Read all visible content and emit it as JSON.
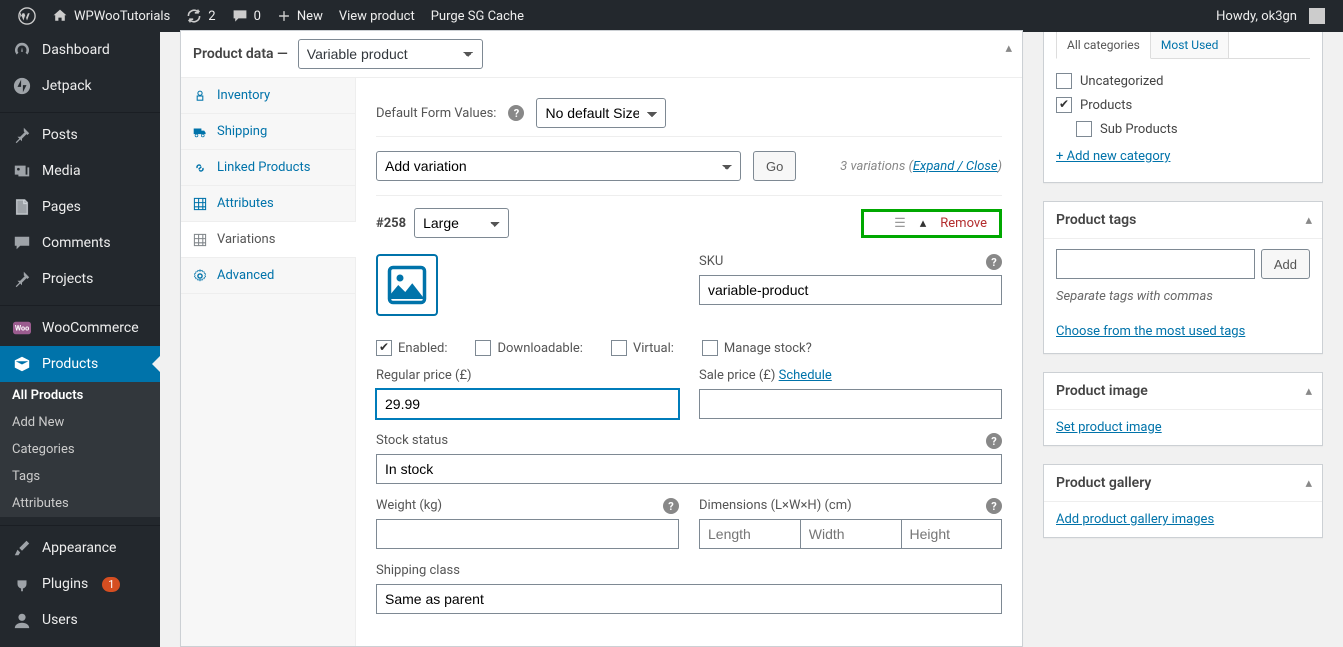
{
  "adminbar": {
    "site_name": "WPWooTutorials",
    "updates": "2",
    "comments": "0",
    "new_label": "New",
    "view_product": "View product",
    "purge_cache": "Purge SG Cache",
    "howdy": "Howdy, ok3gn"
  },
  "sidebar": {
    "items": [
      {
        "label": "Dashboard",
        "icon": "dashboard"
      },
      {
        "label": "Jetpack",
        "icon": "jetpack"
      },
      {
        "sep": true
      },
      {
        "label": "Posts",
        "icon": "pin"
      },
      {
        "label": "Media",
        "icon": "media"
      },
      {
        "label": "Pages",
        "icon": "page"
      },
      {
        "label": "Comments",
        "icon": "comment"
      },
      {
        "label": "Projects",
        "icon": "pin"
      },
      {
        "sep": true
      },
      {
        "label": "WooCommerce",
        "icon": "woo"
      },
      {
        "label": "Products",
        "icon": "box",
        "active": true
      },
      {
        "sep": true
      },
      {
        "label": "Appearance",
        "icon": "brush"
      },
      {
        "label": "Plugins",
        "icon": "plug",
        "badge": "1"
      },
      {
        "label": "Users",
        "icon": "user"
      }
    ],
    "subitems": [
      {
        "label": "All Products",
        "current": true
      },
      {
        "label": "Add New"
      },
      {
        "label": "Categories"
      },
      {
        "label": "Tags"
      },
      {
        "label": "Attributes"
      }
    ]
  },
  "product_data": {
    "title": "Product data —",
    "type_selected": "Variable product",
    "tabs": [
      {
        "label": "Inventory",
        "icon": "inventory"
      },
      {
        "label": "Shipping",
        "icon": "truck"
      },
      {
        "label": "Linked Products",
        "icon": "link"
      },
      {
        "label": "Attributes",
        "icon": "grid"
      },
      {
        "label": "Variations",
        "icon": "grid",
        "active": true
      },
      {
        "label": "Advanced",
        "icon": "gear"
      }
    ],
    "default_form_values_label": "Default Form Values:",
    "default_form_values_selected": "No default Size…",
    "add_variation_label": "Add variation",
    "go_button": "Go",
    "variations_count_text": "3 variations (",
    "expand_text": "Expand / Close",
    "close_paren": ")",
    "variation_id": "#258",
    "variation_attr_selected": "Large",
    "remove_label": "Remove",
    "sku_label": "SKU",
    "sku_value": "variable-product",
    "checks": {
      "enabled": "Enabled:",
      "downloadable": "Downloadable:",
      "virtual": "Virtual:",
      "manage_stock": "Manage stock?"
    },
    "regular_price_label": "Regular price (£)",
    "regular_price_value": "29.99",
    "sale_price_label": "Sale price (£) ",
    "schedule_link": "Schedule",
    "stock_status_label": "Stock status",
    "stock_status_value": "In stock",
    "weight_label": "Weight (kg)",
    "dimensions_label": "Dimensions (L×W×H) (cm)",
    "dim_length_ph": "Length",
    "dim_width_ph": "Width",
    "dim_height_ph": "Height",
    "shipping_class_label": "Shipping class",
    "shipping_class_value": "Same as parent"
  },
  "sideboxes": {
    "categories": {
      "tab_all": "All categories",
      "tab_used": "Most Used",
      "items": [
        {
          "label": "Uncategorized",
          "checked": false
        },
        {
          "label": "Products",
          "checked": true
        },
        {
          "label": "Sub Products",
          "checked": false,
          "indent": true
        }
      ],
      "add_new": "+ Add new category"
    },
    "tags": {
      "title": "Product tags",
      "add_button": "Add",
      "hint": "Separate tags with commas",
      "choose_link": "Choose from the most used tags"
    },
    "image": {
      "title": "Product image",
      "link": "Set product image"
    },
    "gallery": {
      "title": "Product gallery",
      "link": "Add product gallery images"
    }
  }
}
